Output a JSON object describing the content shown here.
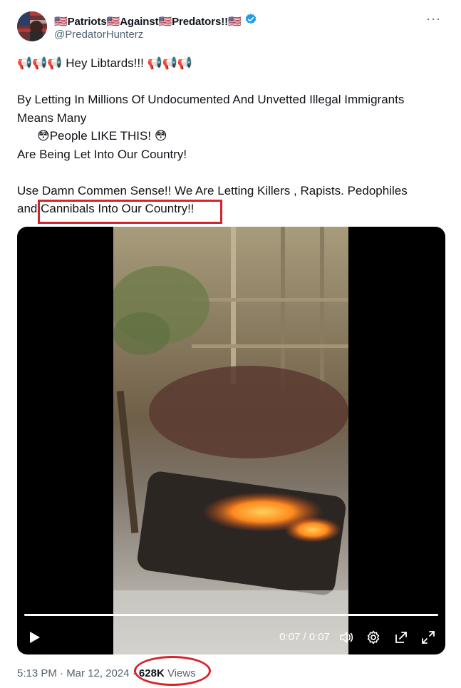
{
  "author": {
    "display_name": "🇺🇸Patriots🇺🇸Against🇺🇸Predators!!🇺🇸",
    "handle": "@PredatorHunterz",
    "verified": true
  },
  "more_label": "···",
  "tweet": {
    "lines": [
      "📢📢📢 Hey Libtards!!! 📢📢📢",
      "By Letting In Millions Of Undocumented And Unvetted Illegal Immigrants",
      "Means Many",
      "😳People LIKE THIS! 😳",
      "Are Being Let Into Our Country!",
      "Use Damn Commen Sense!! We Are Letting Killers , Rapists. Pedophiles",
      "and Cannibals Into Our Country!!"
    ]
  },
  "video": {
    "time": "0:07 / 0:07",
    "progress": 1.0,
    "controls": [
      "play-icon",
      "volume-icon",
      "settings-icon",
      "pop-out-icon",
      "fullscreen-icon"
    ]
  },
  "meta": {
    "timestamp": "5:13 PM · Mar 12, 2024 · ",
    "views_count": "628K",
    "views_label": " Views"
  },
  "colors": {
    "accent": "#1d9bf0",
    "annotation_red": "#d8232a",
    "secondary_text": "#536471"
  }
}
